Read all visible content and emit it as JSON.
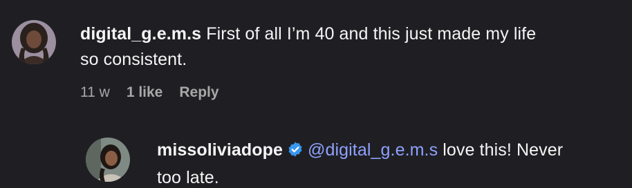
{
  "comment": {
    "username": "digital_g.e.m.s",
    "text_line1": "First of all I’m 40 and this just made my life",
    "text_line2": "so consistent.",
    "time": "11 w",
    "likes": "1 like",
    "reply_label": "Reply",
    "avatar_icon": "profile-photo"
  },
  "reply": {
    "username": "missoliviadope",
    "verified_icon": "verified-badge-icon",
    "mention": "@digital_g.e.m.s",
    "text_line1_rest": "love this! Never",
    "text_line2": "too late.",
    "avatar_icon": "profile-photo"
  },
  "colors": {
    "background": "#1f1f23",
    "mention": "#8fa1ff",
    "verified": "#3897f0",
    "meta": "#a8a8a8"
  }
}
